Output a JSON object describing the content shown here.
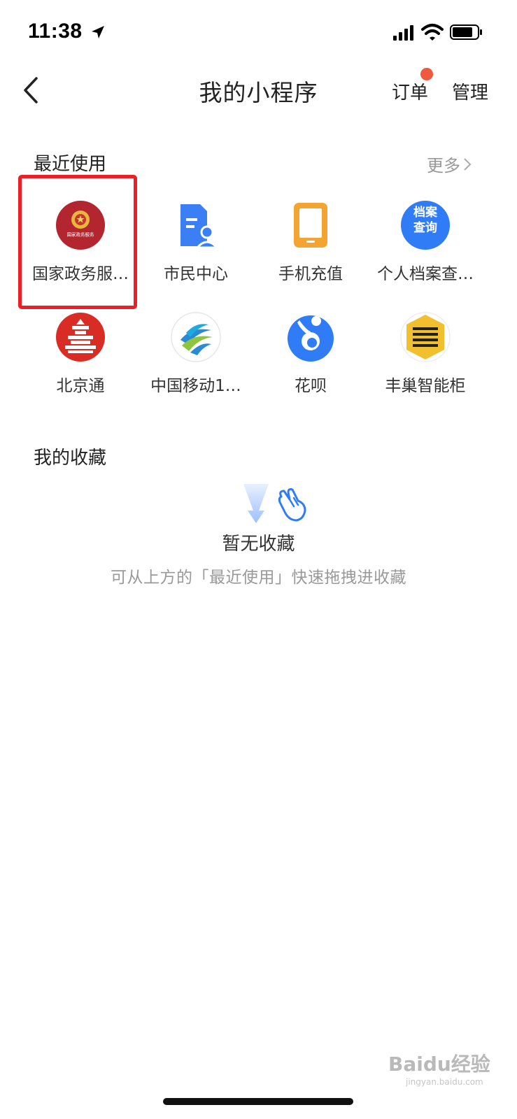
{
  "status_bar": {
    "time": "11:38"
  },
  "nav": {
    "title": "我的小程序",
    "orders_label": "订单",
    "manage_label": "管理"
  },
  "recent": {
    "title": "最近使用",
    "more_label": "更多",
    "items": [
      {
        "label": "国家政务服…",
        "icon": "national-emblem-icon",
        "color": "#c1272d"
      },
      {
        "label": "市民中心",
        "icon": "citizen-card-icon",
        "color": "#3b7ff5"
      },
      {
        "label": "手机充值",
        "icon": "phone-recharge-icon",
        "color": "#f4a531"
      },
      {
        "label": "个人档案查…",
        "icon": "archive-query-icon",
        "color": "#2f7cf6",
        "icon_text": [
          "档案",
          "查询"
        ]
      },
      {
        "label": "北京通",
        "icon": "temple-of-heaven-icon",
        "color": "#d92c24"
      },
      {
        "label": "中国移动1…",
        "icon": "china-mobile-icon",
        "color": "#2a8ad4"
      },
      {
        "label": "花呗",
        "icon": "huabei-icon",
        "color": "#2f7cf6"
      },
      {
        "label": "丰巢智能柜",
        "icon": "hive-box-icon",
        "color": "#f2c02e"
      }
    ],
    "highlighted_index": 0
  },
  "favorites": {
    "title": "我的收藏",
    "empty_title": "暂无收藏",
    "empty_hint": "可从上方的「最近使用」快速拖拽进收藏"
  },
  "watermark": {
    "text": "Baidu经验",
    "sub": "jingyan.baidu.com"
  },
  "colors": {
    "accent_red": "#ec1f24",
    "badge": "#f0583f",
    "muted_text": "#999999"
  }
}
